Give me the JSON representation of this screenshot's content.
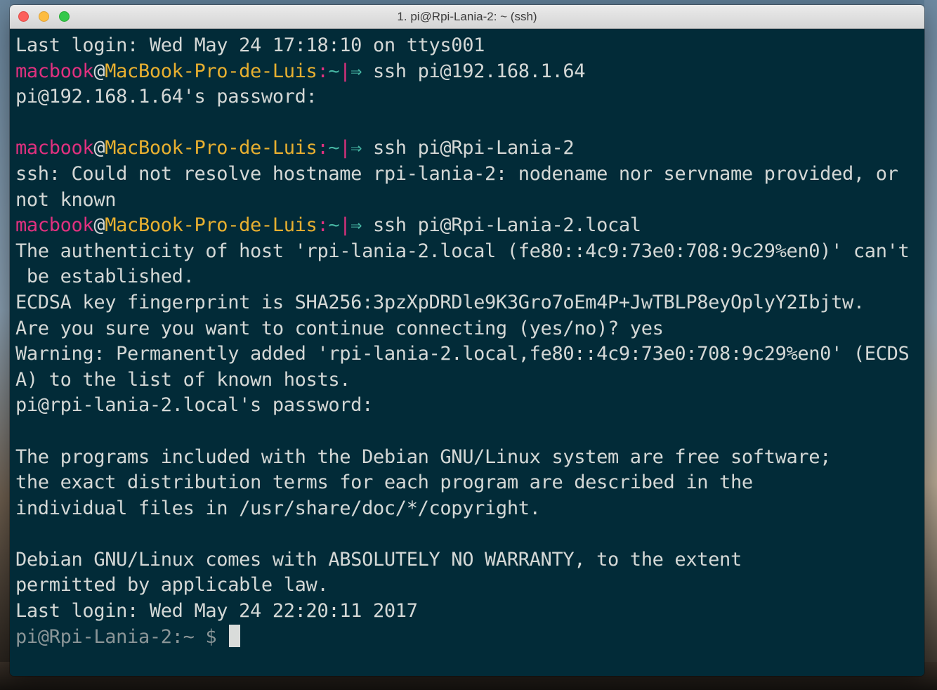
{
  "window": {
    "title": "1. pi@Rpi-Lania-2: ~ (ssh)",
    "colors": {
      "terminal_bg": "#022b38",
      "text": "#d4d8d6",
      "prompt_user": "#e0317f",
      "prompt_host": "#e8b030",
      "prompt_path": "#46b6a3"
    }
  },
  "terminal": {
    "line1": "Last login: Wed May 24 17:18:10 on ttys001",
    "prompt": {
      "user": "macbook",
      "at": "@",
      "host": "MacBook-Pro-de-Luis",
      "colon": ":",
      "path": "~",
      "bar": "|",
      "arrow": "⇒"
    },
    "cmd1": " ssh pi@192.168.1.64",
    "line3": "pi@192.168.1.64's password:",
    "line4": "",
    "cmd2": " ssh pi@Rpi-Lania-2",
    "line6": "ssh: Could not resolve hostname rpi-lania-2: nodename nor servname provided, or",
    "line7": "not known",
    "cmd3": " ssh pi@Rpi-Lania-2.local",
    "line9": "The authenticity of host 'rpi-lania-2.local (fe80::4c9:73e0:708:9c29%en0)' can't",
    "line10": " be established.",
    "line11": "ECDSA key fingerprint is SHA256:3pzXpDRDle9K3Gro7oEm4P+JwTBLP8eyOplyY2Ibjtw.",
    "line12": "Are you sure you want to continue connecting (yes/no)? yes",
    "line13": "Warning: Permanently added 'rpi-lania-2.local,fe80::4c9:73e0:708:9c29%en0' (ECDS",
    "line14": "A) to the list of known hosts.",
    "line15": "pi@rpi-lania-2.local's password:",
    "line16": "",
    "line17": "The programs included with the Debian GNU/Linux system are free software;",
    "line18": "the exact distribution terms for each program are described in the",
    "line19": "individual files in /usr/share/doc/*/copyright.",
    "line20": "",
    "line21": "Debian GNU/Linux comes with ABSOLUTELY NO WARRANTY, to the extent",
    "line22": "permitted by applicable law.",
    "line23": "Last login: Wed May 24 22:20:11 2017",
    "remote_prompt": "pi@Rpi-Lania-2:~ $ "
  }
}
